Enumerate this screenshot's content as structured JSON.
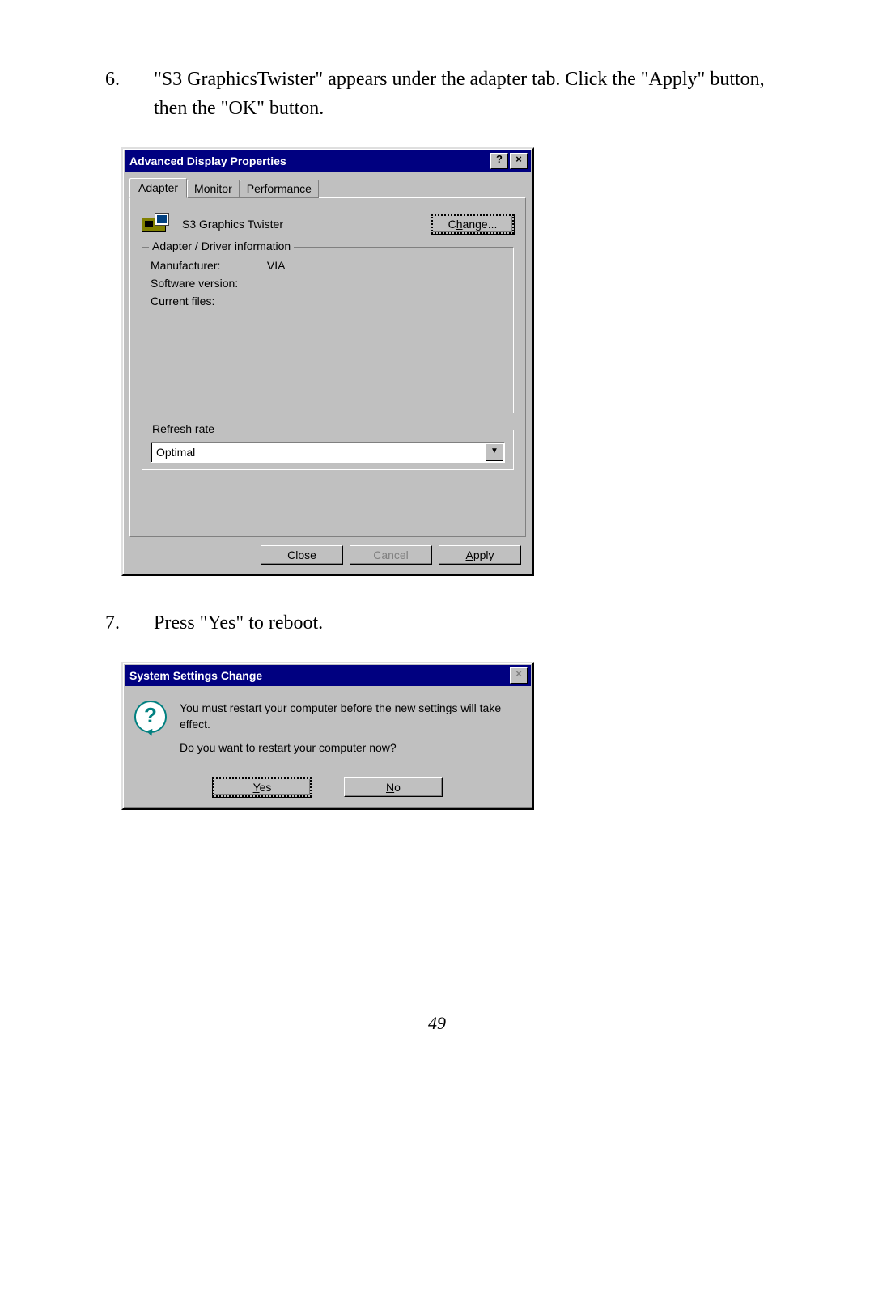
{
  "steps": {
    "s6_num": "6.",
    "s6_text": "\"S3  GraphicsTwister\" appears under the adapter tab. Click the \"Apply\" button, then the \"OK\" button.",
    "s7_num": "7.",
    "s7_text": "Press \"Yes\" to reboot."
  },
  "dialog1": {
    "title": "Advanced Display Properties",
    "help_glyph": "?",
    "close_glyph": "×",
    "tabs": {
      "t0": "Adapter",
      "t1": "Monitor",
      "t2": "Performance"
    },
    "adapter_name": "S3 Graphics Twister",
    "change_pre": "C",
    "change_u": "h",
    "change_post": "ange...",
    "group_driver": "Adapter / Driver information",
    "manufacturer_label": "Manufacturer:",
    "manufacturer_value": "VIA",
    "software_label": "Software version:",
    "files_label": "Current files:",
    "group_refresh_u": "R",
    "group_refresh_rest": "efresh rate",
    "refresh_value": "Optimal",
    "combo_arrow": "▼",
    "close_btn": "Close",
    "cancel_btn": "Cancel",
    "apply_u": "A",
    "apply_rest": "pply"
  },
  "dialog2": {
    "title": "System Settings Change",
    "close_glyph": "×",
    "q_glyph": "?",
    "line1": "You must restart your computer before the new settings will take effect.",
    "line2": "Do you want to restart your computer now?",
    "yes_u": "Y",
    "yes_rest": "es",
    "no_u": "N",
    "no_rest": "o"
  },
  "page_number": "49"
}
